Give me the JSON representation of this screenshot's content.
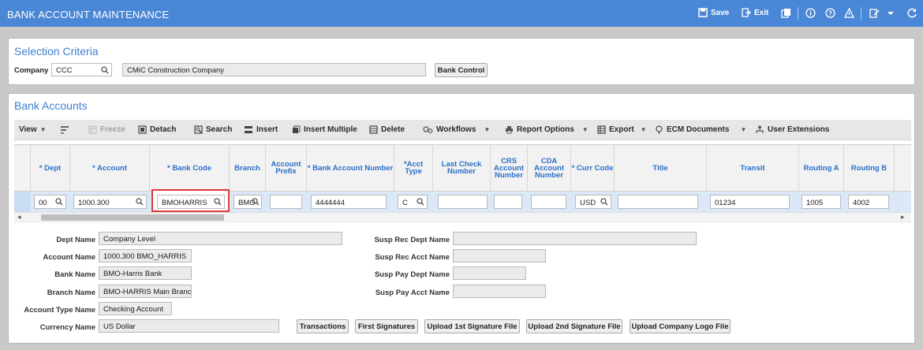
{
  "header": {
    "title": "BANK ACCOUNT MAINTENANCE",
    "save_label": "Save",
    "exit_label": "Exit"
  },
  "selection": {
    "title": "Selection Criteria",
    "company_label": "Company",
    "company_value": "CCC",
    "company_name": "CMiC Construction Company",
    "bank_control_label": "Bank Control"
  },
  "bank_accounts": {
    "title": "Bank Accounts",
    "toolbar": {
      "view": "View",
      "freeze": "Freeze",
      "detach": "Detach",
      "search": "Search",
      "insert": "Insert",
      "insert_multiple": "Insert Multiple",
      "delete": "Delete",
      "workflows": "Workflows",
      "report_options": "Report Options",
      "export": "Export",
      "ecm_documents": "ECM Documents",
      "user_extensions": "User Extensions"
    },
    "columns": {
      "dept": "* Dept",
      "account": "* Account",
      "bank_code": "* Bank Code",
      "branch": "Branch",
      "account_prefix": "Account Prefix",
      "bank_account_number": "* Bank Account Number",
      "acct_type": "*Acct Type",
      "last_check_number": "Last Check Number",
      "crs_account_number": "CRS Account Number",
      "cda_account_number": "CDA Account Number",
      "curr_code": "* Curr Code",
      "title": "Title",
      "transit": "Transit",
      "routing_a": "Routing A",
      "routing_b": "Routing B"
    },
    "row": {
      "dept": "00",
      "account": "1000.300",
      "bank_code": "BMOHARRIS",
      "branch": "BMO-",
      "account_prefix": "",
      "bank_account_number": "4444444",
      "acct_type": "C",
      "last_check_number": "",
      "crs_account_number": "",
      "cda_account_number": "",
      "curr_code": "USD",
      "title": "",
      "transit": "01234",
      "routing_a": "1005",
      "routing_b": "4002"
    }
  },
  "details": {
    "dept_name_label": "Dept Name",
    "dept_name": "Company Level",
    "account_name_label": "Account Name",
    "account_name": "1000.300 BMO_HARRIS",
    "bank_name_label": "Bank Name",
    "bank_name": "BMO-Harris Bank",
    "branch_name_label": "Branch Name",
    "branch_name": "BMO-HARRIS Main Branc",
    "account_type_name_label": "Account Type Name",
    "account_type_name": "Checking Account",
    "currency_name_label": "Currency Name",
    "currency_name": "US Dollar",
    "susp_rec_dept_label": "Susp Rec Dept Name",
    "susp_rec_acct_label": "Susp Rec Acct Name",
    "susp_pay_dept_label": "Susp Pay Dept Name",
    "susp_pay_acct_label": "Susp Pay Acct Name"
  },
  "buttons": {
    "transactions": "Transactions",
    "first_signatures": "First Signatures",
    "upload_1st": "Upload 1st Signature File",
    "upload_2nd": "Upload 2nd Signature File",
    "upload_logo": "Upload Company Logo File"
  },
  "colors": {
    "header_bg": "#4a87d6",
    "accent_text": "#3e7fcf",
    "highlight_border": "#e03a3a",
    "row_selected": "#dbe8f7"
  }
}
